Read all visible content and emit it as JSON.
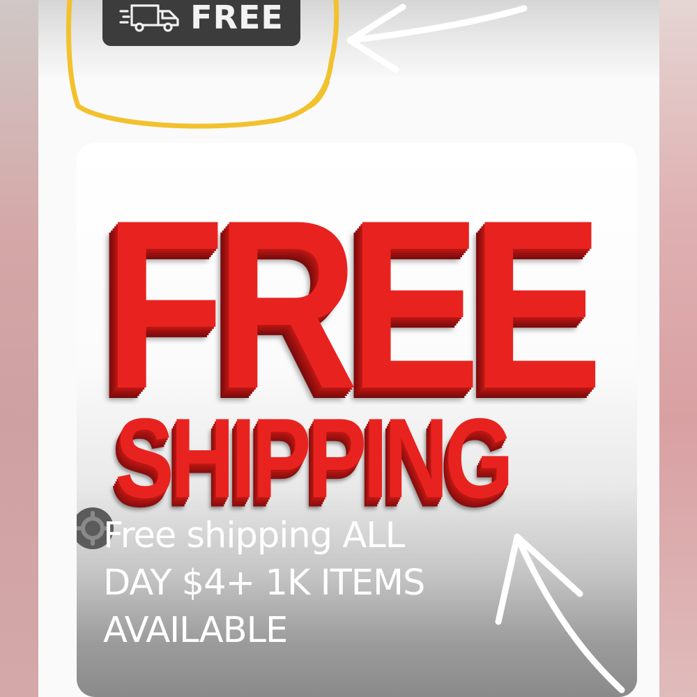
{
  "badge": {
    "icon": "delivery-truck-icon",
    "label": "FREE",
    "background": "#3c3c3c"
  },
  "promo": {
    "headline_top": "FREE",
    "headline_bottom": "SHIPPING",
    "headline_color": "#e8231f",
    "caption_line1": "Free shipping ALL",
    "caption_line2": "DAY  $4+ 1K ITEMS",
    "caption_line3": "AVAILABLE"
  },
  "annotations": {
    "highlight_color": "#f2c12e",
    "arrow_color": "#ffffff"
  }
}
